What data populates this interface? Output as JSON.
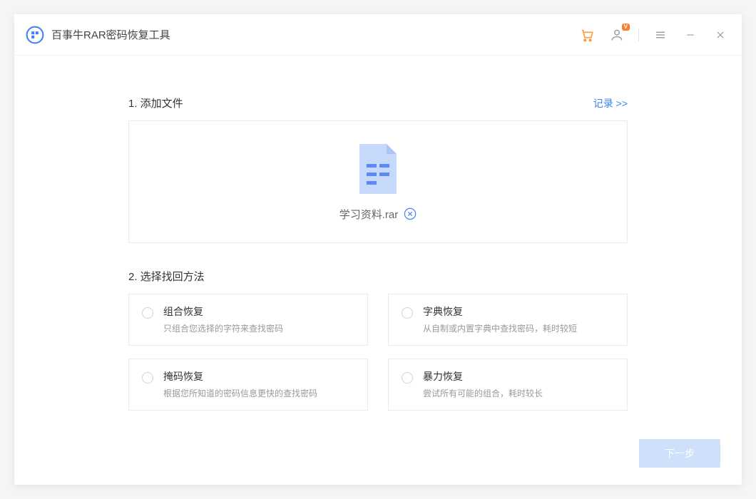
{
  "app": {
    "title": "百事牛RAR密码恢复工具"
  },
  "header": {
    "vip_badge": "V"
  },
  "step1": {
    "title": "1. 添加文件",
    "record_link": "记录 >>",
    "filename": "学习资料.rar"
  },
  "step2": {
    "title": "2. 选择找回方法",
    "methods": [
      {
        "title": "组合恢复",
        "desc": "只组合您选择的字符来查找密码"
      },
      {
        "title": "字典恢复",
        "desc": "从自制或内置字典中查找密码，耗时较短"
      },
      {
        "title": "掩码恢复",
        "desc": "根据您所知道的密码信息更快的查找密码"
      },
      {
        "title": "暴力恢复",
        "desc": "尝试所有可能的组合，耗时较长"
      }
    ]
  },
  "footer": {
    "next": "下一步"
  }
}
